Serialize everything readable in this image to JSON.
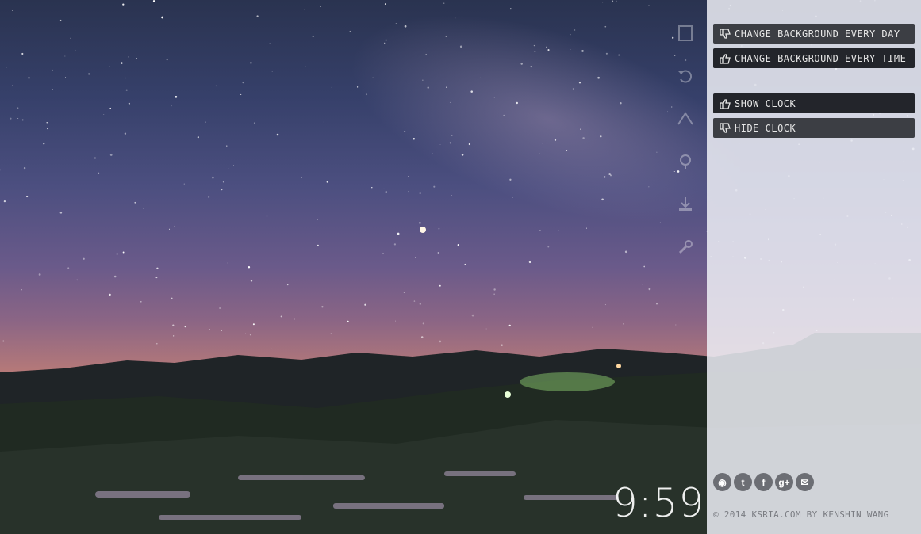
{
  "options": {
    "change_every_day": "CHANGE BACKGROUND EVERY DAY",
    "change_every_time": "CHANGE BACKGROUND EVERY TIME",
    "show_clock": "SHOW CLOCK",
    "hide_clock": "HIDE CLOCK"
  },
  "toolbar_icons": [
    "bookmark-icon",
    "undo-icon",
    "mountain-icon",
    "location-icon",
    "download-icon",
    "wrench-icon"
  ],
  "social": [
    "weibo",
    "twitter",
    "facebook",
    "google-plus",
    "email"
  ],
  "social_glyphs": {
    "weibo": "◉",
    "twitter": "t",
    "facebook": "f",
    "google_plus": "g+",
    "email": "✉"
  },
  "footer": {
    "copyright": "© 2014 KSRIA.COM BY KENSHIN WANG"
  },
  "clock": {
    "time": "9:59"
  },
  "colors": {
    "panel_bg": "#eceef4",
    "button_dark": "#23252b",
    "button_mid": "#3c3e44"
  }
}
